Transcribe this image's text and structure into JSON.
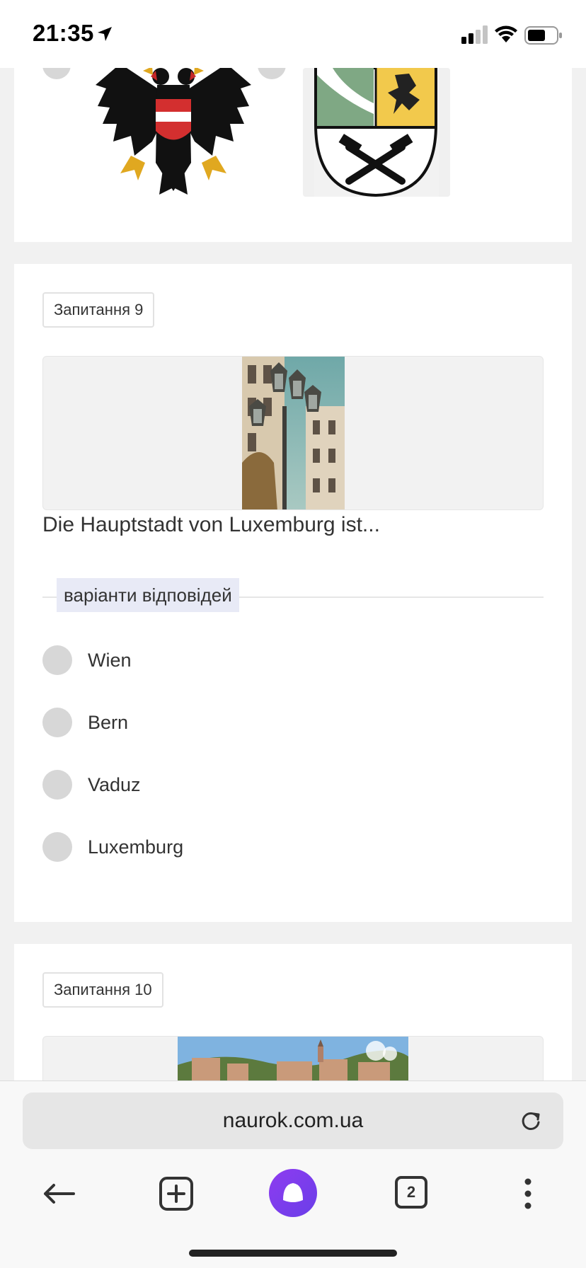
{
  "status_bar": {
    "time": "21:35"
  },
  "question9": {
    "label": "Запитання 9",
    "text": "Die Hauptstadt von Luxemburg ist...",
    "variants_label": "варіанти відповідей",
    "options": [
      "Wien",
      "Bern",
      "Vaduz",
      "Luxemburg"
    ]
  },
  "question10": {
    "label": "Запитання 10"
  },
  "browser": {
    "url": "naurok.com.ua",
    "tab_count": "2"
  },
  "colors": {
    "assistant_button": "#7a3cf0",
    "variants_highlight": "#e8eaf6",
    "radio": "#d7d7d7"
  }
}
